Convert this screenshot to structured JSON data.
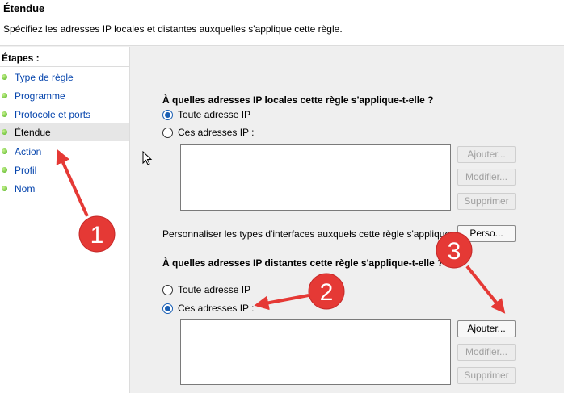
{
  "header": {
    "title": "Étendue",
    "description": "Spécifiez les adresses IP locales et distantes auxquelles s'applique cette règle."
  },
  "sidebar": {
    "title": "Étapes :",
    "items": [
      {
        "label": "Type de règle"
      },
      {
        "label": "Programme"
      },
      {
        "label": "Protocole et ports"
      },
      {
        "label": "Étendue"
      },
      {
        "label": "Action"
      },
      {
        "label": "Profil"
      },
      {
        "label": "Nom"
      }
    ]
  },
  "local": {
    "question": "À quelles adresses IP locales cette règle s'applique-t-elle ?",
    "option_any": "Toute adresse IP",
    "option_these": "Ces adresses IP :",
    "selected": "any",
    "buttons": {
      "add": "Ajouter...",
      "edit": "Modifier...",
      "remove": "Supprimer"
    }
  },
  "interfaces": {
    "label": "Personnaliser les types d'interfaces auxquels cette règle s'applique :",
    "button": "Perso..."
  },
  "remote": {
    "question": "À quelles adresses IP distantes cette règle s'applique-t-elle ?",
    "option_any": "Toute adresse IP",
    "option_these": "Ces adresses IP :",
    "selected": "these",
    "buttons": {
      "add": "Ajouter...",
      "edit": "Modifier...",
      "remove": "Supprimer"
    }
  },
  "annotations": {
    "badge1": "1",
    "badge2": "2",
    "badge3": "3",
    "color": "#e53935"
  }
}
